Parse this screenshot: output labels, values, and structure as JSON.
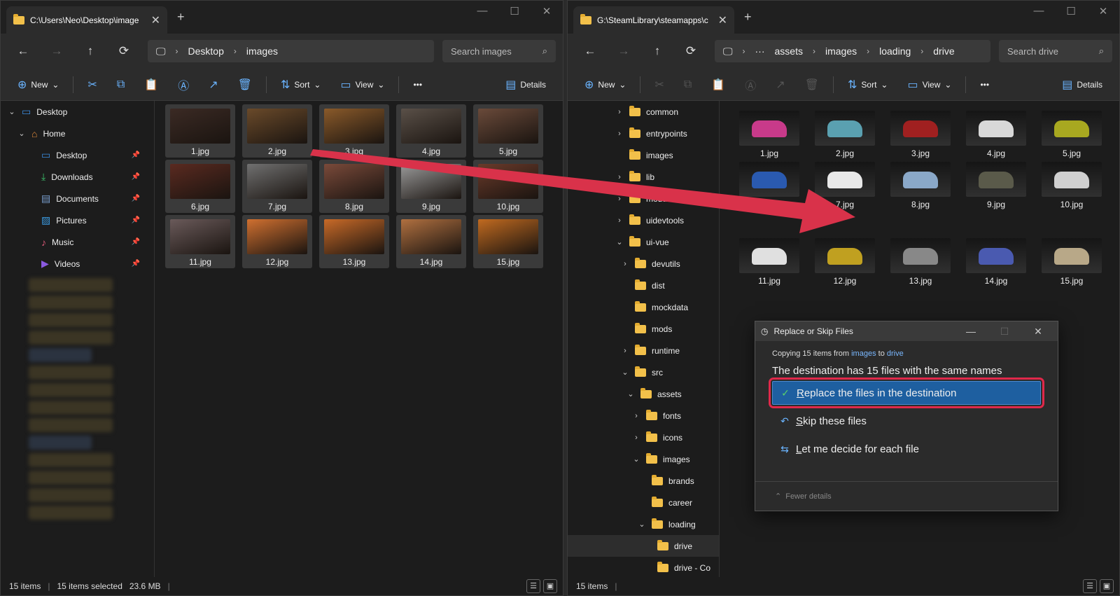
{
  "left": {
    "tab_title": "C:\\Users\\Neo\\Desktop\\image",
    "breadcrumb": [
      "Desktop",
      "images"
    ],
    "search_placeholder": "Search images",
    "cmd": {
      "new": "New",
      "sort": "Sort",
      "view": "View",
      "details": "Details"
    },
    "tree": [
      {
        "label": "Desktop",
        "indent": 0,
        "chev": "⌄",
        "icon": "desktop"
      },
      {
        "label": "Home",
        "indent": 1,
        "chev": "⌄",
        "icon": "home"
      },
      {
        "label": "Desktop",
        "indent": 2,
        "chev": "",
        "icon": "desktop",
        "pinned": true
      },
      {
        "label": "Downloads",
        "indent": 2,
        "chev": "",
        "icon": "download",
        "pinned": true
      },
      {
        "label": "Documents",
        "indent": 2,
        "chev": "",
        "icon": "docs",
        "pinned": true
      },
      {
        "label": "Pictures",
        "indent": 2,
        "chev": "",
        "icon": "pictures",
        "pinned": true
      },
      {
        "label": "Music",
        "indent": 2,
        "chev": "",
        "icon": "music",
        "pinned": true
      },
      {
        "label": "Videos",
        "indent": 2,
        "chev": "",
        "icon": "videos",
        "pinned": true
      }
    ],
    "files": [
      "1.jpg",
      "2.jpg",
      "3.jpg",
      "4.jpg",
      "5.jpg",
      "6.jpg",
      "7.jpg",
      "8.jpg",
      "9.jpg",
      "10.jpg",
      "11.jpg",
      "12.jpg",
      "13.jpg",
      "14.jpg",
      "15.jpg"
    ],
    "thumb_colors": [
      "#3b2a24",
      "#6a4a2a",
      "#8a5a2a",
      "#5a5048",
      "#6a4a3a",
      "#5a2a20",
      "#707070",
      "#7a4a3a",
      "#9a9a9a",
      "#6a3a2a",
      "#6a5a5a",
      "#d07030",
      "#c86a28",
      "#b07040",
      "#c06a20"
    ],
    "status": {
      "count": "15 items",
      "selected": "15 items selected",
      "size": "23.6 MB"
    }
  },
  "right": {
    "tab_title": "G:\\SteamLibrary\\steamapps\\c",
    "breadcrumb": [
      "···",
      "assets",
      "images",
      "loading",
      "drive"
    ],
    "search_placeholder": "Search drive",
    "cmd": {
      "new": "New",
      "sort": "Sort",
      "view": "View",
      "details": "Details"
    },
    "tree": [
      {
        "label": "common",
        "indent": 0,
        "chev": "›"
      },
      {
        "label": "entrypoints",
        "indent": 0,
        "chev": "›"
      },
      {
        "label": "images",
        "indent": 0,
        "chev": ""
      },
      {
        "label": "lib",
        "indent": 0,
        "chev": "›"
      },
      {
        "label": "modules",
        "indent": 0,
        "chev": "›"
      },
      {
        "label": "uidevtools",
        "indent": 0,
        "chev": "›"
      },
      {
        "label": "ui-vue",
        "indent": 0,
        "chev": "⌄"
      },
      {
        "label": "devutils",
        "indent": 1,
        "chev": "›"
      },
      {
        "label": "dist",
        "indent": 1,
        "chev": ""
      },
      {
        "label": "mockdata",
        "indent": 1,
        "chev": ""
      },
      {
        "label": "mods",
        "indent": 1,
        "chev": ""
      },
      {
        "label": "runtime",
        "indent": 1,
        "chev": "›"
      },
      {
        "label": "src",
        "indent": 1,
        "chev": "⌄"
      },
      {
        "label": "assets",
        "indent": 2,
        "chev": "⌄"
      },
      {
        "label": "fonts",
        "indent": 3,
        "chev": "›"
      },
      {
        "label": "icons",
        "indent": 3,
        "chev": "›"
      },
      {
        "label": "images",
        "indent": 3,
        "chev": "⌄"
      },
      {
        "label": "brands",
        "indent": 4,
        "chev": ""
      },
      {
        "label": "career",
        "indent": 4,
        "chev": ""
      },
      {
        "label": "loading",
        "indent": 4,
        "chev": "⌄"
      },
      {
        "label": "drive",
        "indent": 5,
        "chev": "",
        "selected": true
      },
      {
        "label": "drive - Co",
        "indent": 5,
        "chev": ""
      }
    ],
    "files": [
      "1.jpg",
      "2.jpg",
      "3.jpg",
      "4.jpg",
      "5.jpg",
      "6.jpg",
      "7.jpg",
      "8.jpg",
      "9.jpg",
      "10.jpg",
      "11.jpg",
      "12.jpg",
      "13.jpg",
      "14.jpg",
      "15.jpg"
    ],
    "car_colors": [
      "#c83a8a",
      "#5aa0b0",
      "#a02020",
      "#d8d8d8",
      "#a8a820",
      "#2a5ab0",
      "#e8e8e8",
      "#8aa8c8",
      "#5a5a4a",
      "#d0d0d0",
      "#e0e0e0",
      "#c0a020",
      "#888888",
      "#4a5ab0",
      "#b8a888"
    ],
    "status": {
      "count": "15 items"
    }
  },
  "dialog": {
    "title": "Replace or Skip Files",
    "copying_prefix": "Copying 15 items from",
    "source": "images",
    "to": "to",
    "destination": "drive",
    "message": "The destination has 15 files with the same names",
    "options": [
      {
        "first": "R",
        "rest": "eplace the files in the destination"
      },
      {
        "first": "S",
        "rest": "kip these files"
      },
      {
        "first": "L",
        "rest": "et me decide for each file"
      }
    ],
    "fewer_details": "Fewer details"
  }
}
